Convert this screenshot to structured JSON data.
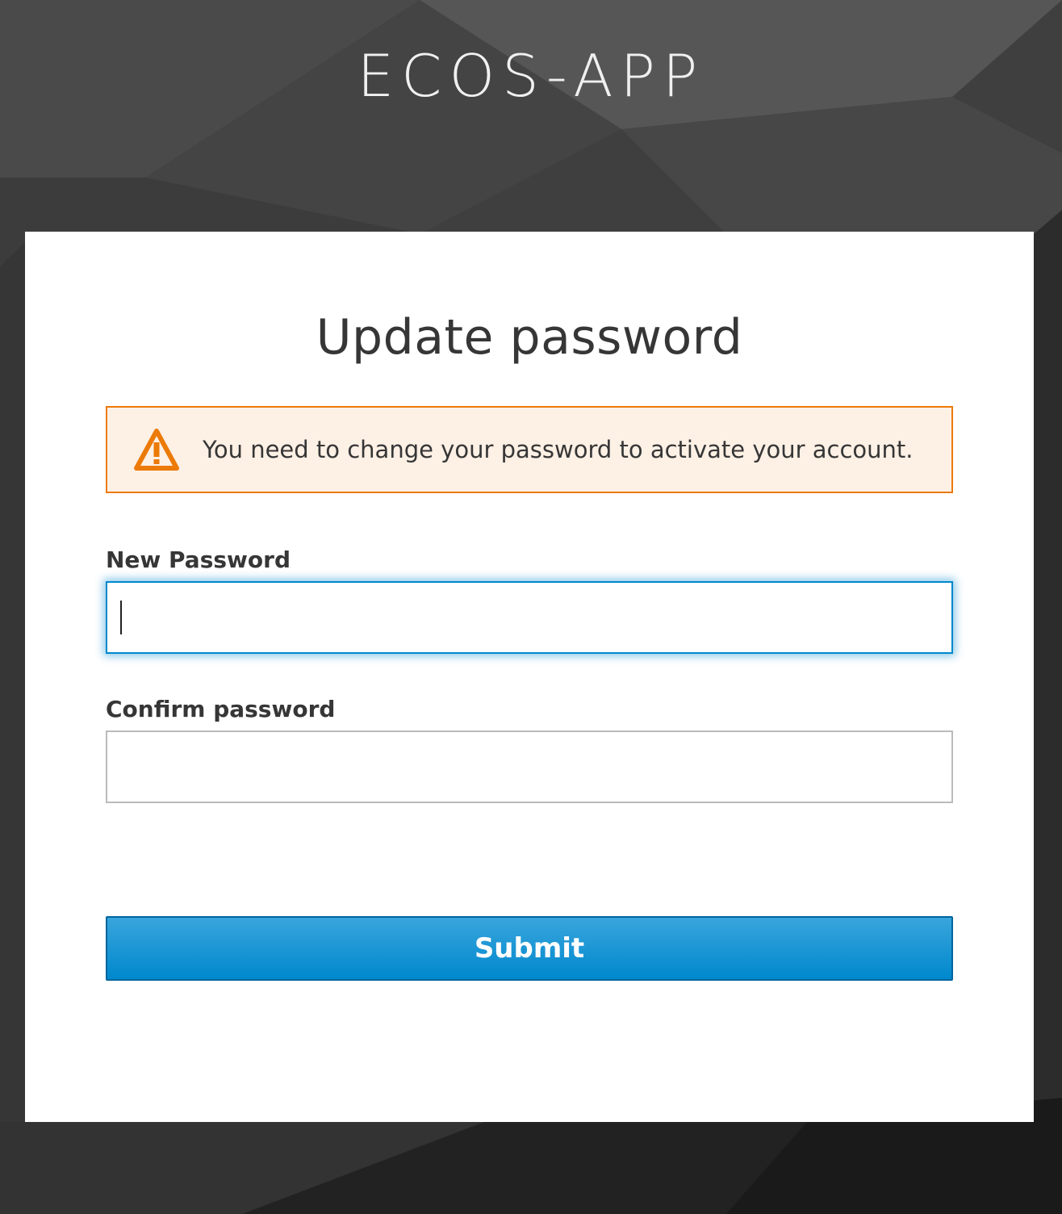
{
  "app": {
    "brand": "ECOS-APP"
  },
  "card": {
    "title": "Update password",
    "alert": {
      "icon": "warning-triangle-icon",
      "message": "You need to change your password to activate your account.",
      "color": "#ec7a08",
      "background": "#fdf0e5"
    },
    "fields": {
      "new_password": {
        "label": "New Password",
        "value": ""
      },
      "confirm_password": {
        "label": "Confirm password",
        "value": ""
      }
    },
    "submit_label": "Submit"
  },
  "colors": {
    "accent": "#0088ce",
    "button_top": "#39a5dc",
    "text": "#363636"
  }
}
